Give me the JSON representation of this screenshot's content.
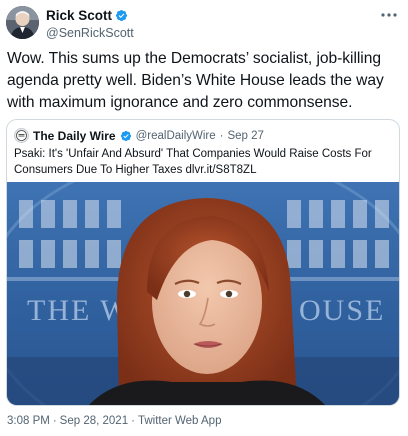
{
  "author": {
    "name": "Rick Scott",
    "handle": "@SenRickScott",
    "verified": true,
    "verified_color": "#1d9bf0"
  },
  "tweet": {
    "text": "Wow. This sums up the Democrats’ socialist, job-killing agenda pretty well. Biden’s White House leads the way with maximum ignorance and zero commonsense."
  },
  "quoted": {
    "name": "The Daily Wire",
    "handle": "@realDailyWire",
    "separator": "·",
    "date": "Sep 27",
    "verified": true,
    "text": "Psaki: It's 'Unfair And Absurd' That Companies Would Raise Costs For Consumers Due To Higher Taxes dlvr.it/S8T8ZL",
    "image_icon": "press-briefing-photo",
    "image_caption_words": "THE WHITE HOUSE"
  },
  "footer": {
    "time": "3:08 PM",
    "separator": "·",
    "date": "Sep 28, 2021",
    "source": "Twitter Web App"
  },
  "icons": {
    "more": "more-horizontal-icon",
    "verified": "verified-badge-icon"
  },
  "colors": {
    "text_primary": "#0f1419",
    "text_secondary": "#536471",
    "border": "#cfd9de",
    "accent": "#1d9bf0"
  }
}
